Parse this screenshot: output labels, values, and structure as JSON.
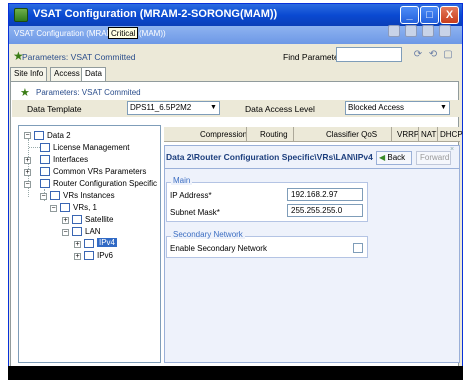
{
  "window": {
    "title": "VSAT Configuration (MRAM-2-SORONG(MAM))",
    "subtitle_left": "VSAT Configuration (MRAM-2-",
    "subtitle_right": "(MAM))",
    "tooltip": "Critical",
    "minimize": "_",
    "maximize": "□",
    "close": "X"
  },
  "params": {
    "label": "Parameters: VSAT Committed",
    "find_label": "Find Parameter",
    "find_value": ""
  },
  "tabs": [
    {
      "label": "Site Info"
    },
    {
      "label": "Access"
    },
    {
      "label": "Data"
    }
  ],
  "data_tab": {
    "params_label": "Parameters: VSAT Commited",
    "template_label": "Data Template",
    "template_value": "DPS11_6.5P2M2",
    "access_label": "Data Access Level",
    "access_value": "Blocked Access"
  },
  "tree": {
    "root": "Data 2",
    "items": [
      {
        "label": "License Management"
      },
      {
        "label": "Interfaces"
      },
      {
        "label": "Common VRs Parameters"
      },
      {
        "label": "Router Configuration Specific"
      },
      {
        "label": "VRs Instances"
      },
      {
        "label": "VRs, 1"
      },
      {
        "label": "Satellite"
      },
      {
        "label": "LAN"
      },
      {
        "label": "IPv4"
      },
      {
        "label": "IPv6"
      }
    ]
  },
  "columns": [
    "Compression",
    "Routing",
    "Classifier QoS",
    "VRRP",
    "NAT",
    "DHCP"
  ],
  "detail": {
    "breadcrumb": "Data 2\\Router Configuration Specific\\VRs\\LAN\\IPv4",
    "back_label": "Back",
    "forward_label": "Forward",
    "main_group": "Main",
    "ip_label": "IP Address*",
    "ip_value": "192.168.2.97",
    "mask_label": "Subnet Mask*",
    "mask_value": "255.255.255.0",
    "secondary_group": "Secondary Network",
    "enable_label": "Enable Secondary Network"
  }
}
